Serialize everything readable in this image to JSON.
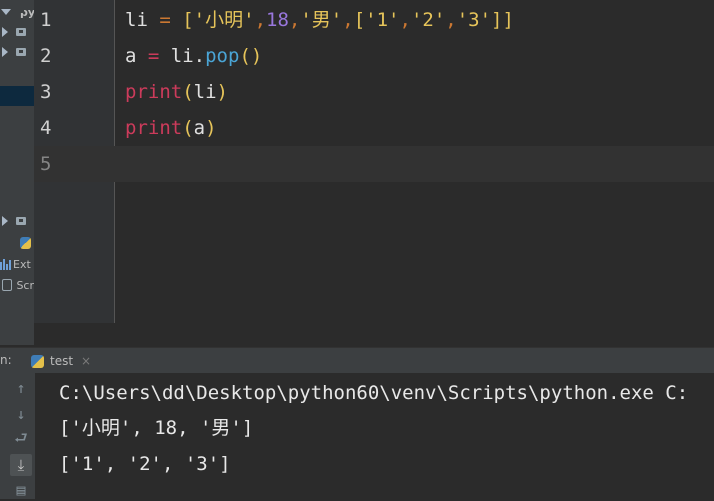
{
  "sidebar": {
    "root_label": "py",
    "external_label": "Ext",
    "scratches_label": "Scr"
  },
  "editor": {
    "lines": [
      {
        "num": "1"
      },
      {
        "num": "2"
      },
      {
        "num": "3"
      },
      {
        "num": "4"
      },
      {
        "num": "5"
      }
    ],
    "code": {
      "l1": {
        "var": "li",
        "eq": " = ",
        "open": "[",
        "s1": "'小明'",
        "c1": ",",
        "n1": "18",
        "c2": ",",
        "s2": "'男'",
        "c3": ",",
        "open2": "[",
        "s3": "'1'",
        "c4": ",",
        "s4": "'2'",
        "c5": ",",
        "s5": "'3'",
        "close2": "]",
        "close": "]"
      },
      "l2": {
        "var": "a",
        "eq": " = ",
        "obj": "li.",
        "method": "pop",
        "parens": "()"
      },
      "l3": {
        "kw": "print",
        "open": "(",
        "arg": "li",
        "close": ")"
      },
      "l4": {
        "kw": "print",
        "open": "(",
        "arg": "a",
        "close": ")"
      }
    }
  },
  "run_panel": {
    "label": "n:",
    "tab_label": "test",
    "tab_close": "×",
    "output": [
      "C:\\Users\\dd\\Desktop\\python60\\venv\\Scripts\\python.exe C:",
      "['小明', 18, '男']",
      "['1', '2', '3']"
    ]
  },
  "colors": {
    "keyword": "#cc3b5b",
    "string": "#e6c45a",
    "number": "#9977dd",
    "function": "#4aa5d6",
    "background": "#2b2b2b"
  }
}
